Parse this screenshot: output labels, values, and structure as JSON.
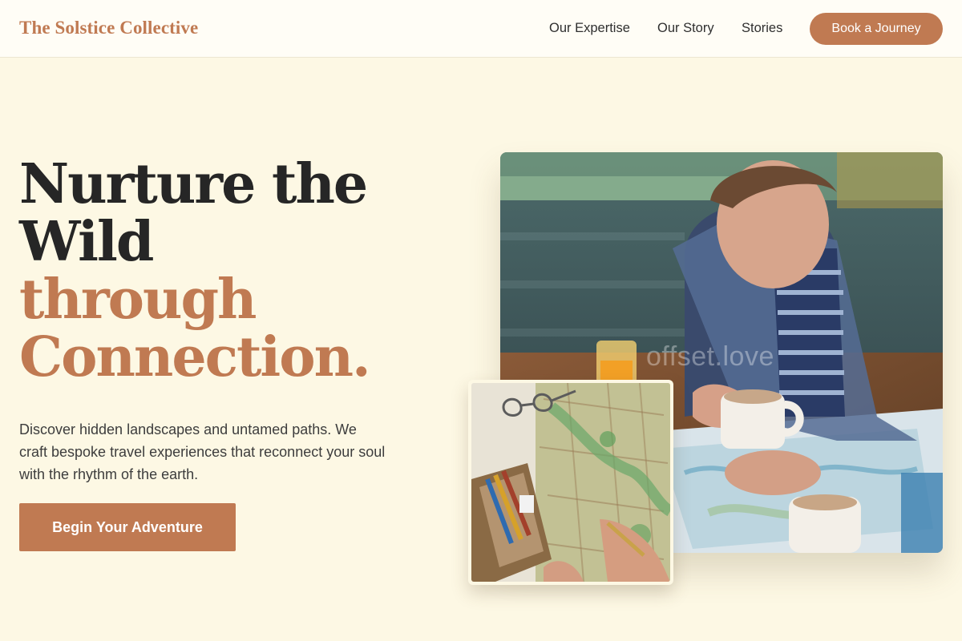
{
  "header": {
    "brand": "The Solstice Collective",
    "nav": [
      "Our Expertise",
      "Our Story",
      "Stories"
    ],
    "cta": "Book a Journey"
  },
  "hero": {
    "headline_line1": "Nurture the",
    "headline_line2": "Wild",
    "headline_accent_line1": "through",
    "headline_accent_line2": "Connection.",
    "intro": "Discover hidden landscapes and untamed paths. We craft bespoke travel experiences that reconnect your soul with the rhythm of the earth.",
    "cta": "Begin Your Adventure"
  },
  "media": {
    "main_watermark": "offset.love"
  },
  "colors": {
    "accent": "#c07a52",
    "background": "#fdf8e4",
    "text": "#262626"
  }
}
